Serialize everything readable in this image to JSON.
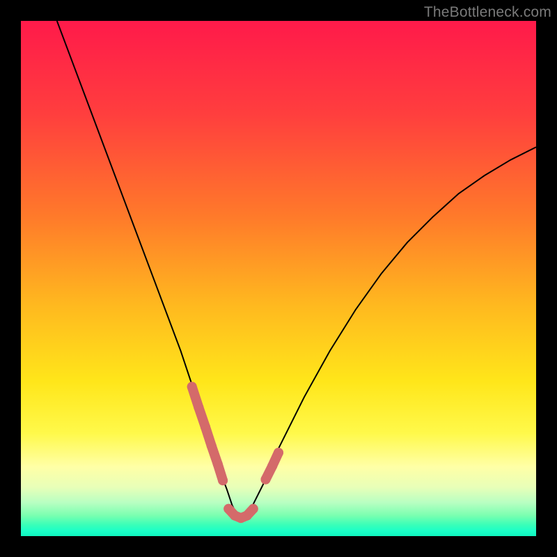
{
  "watermark": "TheBottleneck.com",
  "chart_data": {
    "type": "line",
    "title": "",
    "xlabel": "",
    "ylabel": "",
    "xlim": [
      0,
      100
    ],
    "ylim": [
      0,
      100
    ],
    "grid": false,
    "series": [
      {
        "name": "bottleneck-curve",
        "x": [
          7,
          10,
          13,
          16,
          19,
          22,
          25,
          28,
          31,
          33,
          35,
          37,
          38.5,
          40,
          41,
          42,
          43,
          44,
          45,
          47,
          50,
          55,
          60,
          65,
          70,
          75,
          80,
          85,
          90,
          95,
          100
        ],
        "y": [
          100,
          92,
          84,
          76,
          68,
          60,
          52,
          44,
          36,
          30,
          24,
          18,
          13,
          9,
          6,
          4,
          3.5,
          4,
          6,
          10,
          17,
          27,
          36,
          44,
          51,
          57,
          62,
          66.5,
          70,
          73,
          75.5
        ],
        "style": {
          "stroke": "#000000",
          "strokeWidth": 2
        }
      },
      {
        "name": "highlight-segment-left",
        "x": [
          33.2,
          34.5,
          35.8,
          37.0,
          38.2,
          39.2
        ],
        "y": [
          29.0,
          25.0,
          21.2,
          17.5,
          14.0,
          10.8
        ],
        "style": {
          "stroke": "#d46a6a",
          "strokeWidth": 14,
          "lineCap": "round"
        }
      },
      {
        "name": "highlight-segment-bottom",
        "x": [
          40.3,
          41.5,
          42.7,
          43.9,
          45.1
        ],
        "y": [
          5.3,
          4.0,
          3.5,
          4.0,
          5.3
        ],
        "style": {
          "stroke": "#d46a6a",
          "strokeWidth": 14,
          "lineCap": "round"
        }
      },
      {
        "name": "highlight-segment-right",
        "x": [
          47.5,
          48.8,
          50.0
        ],
        "y": [
          11.0,
          13.6,
          16.2
        ],
        "style": {
          "stroke": "#d46a6a",
          "strokeWidth": 14,
          "lineCap": "round"
        }
      }
    ],
    "background_gradient": {
      "type": "vertical",
      "stops": [
        {
          "offset": 0.0,
          "color": "#ff1a4a"
        },
        {
          "offset": 0.18,
          "color": "#ff3e3e"
        },
        {
          "offset": 0.38,
          "color": "#ff7a2a"
        },
        {
          "offset": 0.55,
          "color": "#ffb81f"
        },
        {
          "offset": 0.7,
          "color": "#ffe61a"
        },
        {
          "offset": 0.8,
          "color": "#fff94a"
        },
        {
          "offset": 0.865,
          "color": "#ffffa6"
        },
        {
          "offset": 0.905,
          "color": "#e8ffb8"
        },
        {
          "offset": 0.935,
          "color": "#b8ffc2"
        },
        {
          "offset": 0.96,
          "color": "#7affb0"
        },
        {
          "offset": 0.978,
          "color": "#3affb8"
        },
        {
          "offset": 0.99,
          "color": "#1affc8"
        },
        {
          "offset": 1.0,
          "color": "#10f5c0"
        }
      ]
    }
  }
}
